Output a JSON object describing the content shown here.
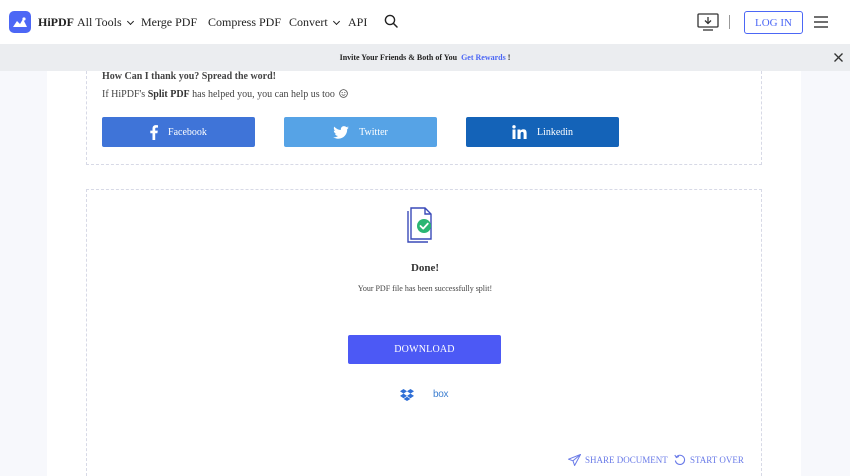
{
  "header": {
    "brand": "HiPDF",
    "nav": [
      {
        "label": "All Tools",
        "has_dropdown": true
      },
      {
        "label": "Merge PDF",
        "has_dropdown": false
      },
      {
        "label": "Compress PDF",
        "has_dropdown": false
      },
      {
        "label": "Convert",
        "has_dropdown": true
      },
      {
        "label": "API",
        "has_dropdown": false
      }
    ],
    "login_label": "LOG IN",
    "icons": [
      "logo-icon",
      "search-icon",
      "desktop-download-icon",
      "hamburger-menu-icon"
    ]
  },
  "banner": {
    "text_before": "Invite Your Friends & Both of You",
    "link_text": "Get Rewards",
    "text_after": "!"
  },
  "share": {
    "title": "How Can I thank you? Spread the word!",
    "subtitle_before": "If HiPDF's",
    "subtitle_bold": "Split PDF",
    "subtitle_after": "has helped you, you can help us too",
    "buttons": [
      {
        "label": "Facebook",
        "icon": "facebook-icon",
        "color": "#3f74d8"
      },
      {
        "label": "Twitter",
        "icon": "twitter-icon",
        "color": "#56a3e6"
      },
      {
        "label": "Linkedin",
        "icon": "linkedin-icon",
        "color": "#1463b8"
      }
    ]
  },
  "result": {
    "title": "Done!",
    "message": "Your PDF file has been successfully split!",
    "download_label": "DOWNLOAD",
    "cloud_targets": [
      "dropbox-icon",
      "box-icon"
    ],
    "box_label": "box",
    "share_document_label": "SHARE DOCUMENT",
    "start_over_label": "START OVER"
  },
  "colors": {
    "accent": "#4c67f5",
    "download_button": "#4c59f5",
    "success": "#2bb673"
  }
}
